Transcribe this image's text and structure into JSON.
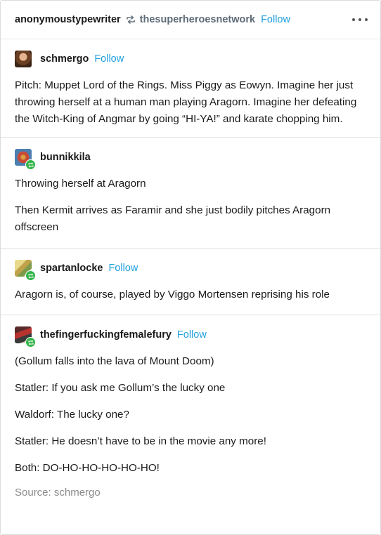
{
  "header": {
    "reblogger": "anonymoustypewriter",
    "reblogged_from": "thesuperheroesnetwork",
    "follow_label": "Follow"
  },
  "trail": [
    {
      "user": "schmergo",
      "follow_label": "Follow",
      "paragraphs": [
        "Pitch: Muppet Lord of the Rings. Miss Piggy as Eowyn. Imagine her just throwing herself at a human man playing Aragorn. Imagine her defeating the Witch-King of Angmar by going “HI-YA!” and karate chopping him."
      ]
    },
    {
      "user": "bunnikkila",
      "paragraphs": [
        "Throwing herself at Aragorn",
        "Then Kermit arrives as Faramir and she just bodily pitches Aragorn offscreen"
      ]
    },
    {
      "user": "spartanlocke",
      "follow_label": "Follow",
      "paragraphs": [
        "Aragorn is, of course, played by Viggo Mortensen reprising his role"
      ]
    },
    {
      "user": "thefingerfuckingfemalefury",
      "follow_label": "Follow",
      "paragraphs": [
        "(Gollum falls into the lava of Mount Doom)",
        "Statler: If you ask me Gollum’s the lucky one",
        "Waldorf: The lucky one?",
        "Statler: He doesn’t have to be in the movie any more!",
        "Both: DO-HO-HO-HO-HO-HO!"
      ]
    }
  ],
  "source": "Source: schmergo",
  "colors": {
    "follow": "#1fa0dc",
    "reblog_badge": "#33b54a",
    "muted": "#8a8a8a"
  }
}
